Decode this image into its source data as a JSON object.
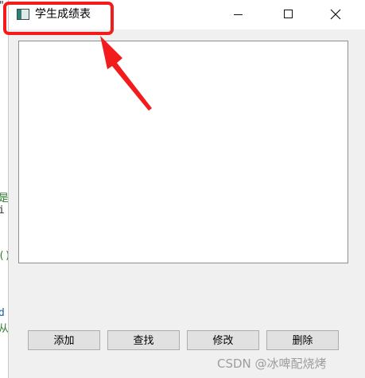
{
  "background_code": {
    "lines": [
      "\"",
      "是",
      "i",
      "()",
      "d",
      "从"
    ]
  },
  "window": {
    "title": "学生成绩表",
    "icon": "app-window-icon"
  },
  "controls": {
    "minimize_icon": "minimize-icon",
    "maximize_icon": "maximize-icon",
    "close_icon": "close-icon"
  },
  "text_area": {
    "value": ""
  },
  "buttons": {
    "add_label": "添加",
    "find_label": "查找",
    "edit_label": "修改",
    "delete_label": "删除"
  },
  "watermark": "CSDN @冰啤配烧烤",
  "colors": {
    "annotation_red": "#f21c1c",
    "window_bg": "#f0f0f0",
    "button_bg": "#e1e1e1"
  }
}
